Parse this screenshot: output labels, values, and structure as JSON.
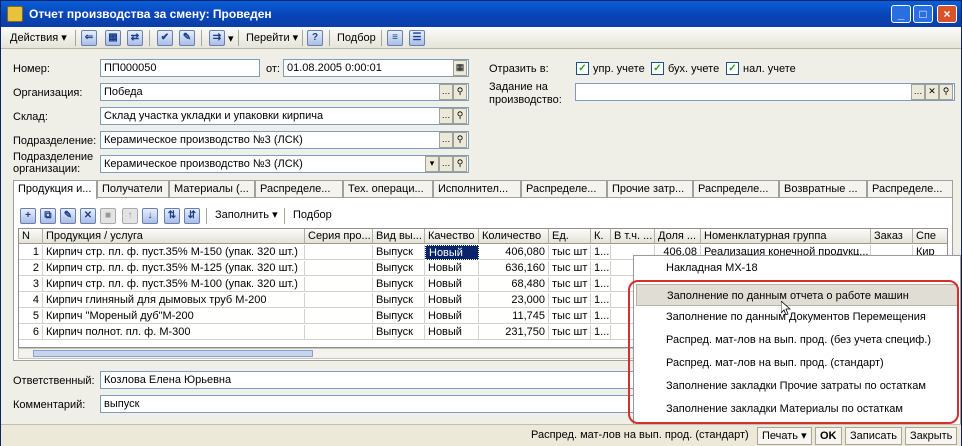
{
  "window": {
    "title": "Отчет производства за смену: Проведен",
    "min": "_",
    "max": "□",
    "close": "×"
  },
  "toolbar": {
    "actions": "Действия",
    "goto": "Перейти",
    "help": "?",
    "select": "Подбор"
  },
  "form": {
    "number_label": "Номер:",
    "number_value": "ПП000050",
    "from_label": "от:",
    "date_value": "01.08.2005  0:00:01",
    "org_label": "Организация:",
    "org_value": "Победа",
    "warehouse_label": "Склад:",
    "warehouse_value": "Склад участка укладки и упаковки кирпича",
    "division_label": "Подразделение:",
    "division_value": "Керамическое производство №3 (ЛСК)",
    "org_division_label_1": "Подразделение",
    "org_division_label_2": "организации:",
    "org_division_value": "Керамическое производство №3 (ЛСК)",
    "reflect_label": "Отразить в:",
    "reflect_mgmt": "упр. учете",
    "reflect_acc": "бух. учете",
    "reflect_tax": "нал. учете",
    "task_label_1": "Задание на",
    "task_label_2": "производство:",
    "task_value": "",
    "responsible_label": "Ответственный:",
    "responsible_value": "Козлова Елена Юрьевна",
    "comment_label": "Комментарий:",
    "comment_value": "выпуск"
  },
  "tabs": [
    "Продукция и...",
    "Получатели",
    "Материалы (...",
    "Распределе...",
    "Тех. операци...",
    "Исполнител...",
    "Распределе...",
    "Прочие затр...",
    "Распределе...",
    "Возвратные ...",
    "Распределе..."
  ],
  "panel_toolbar": {
    "fill": "Заполнить",
    "select": "Подбор"
  },
  "grid": {
    "headers": [
      "N",
      "Продукция / услуга",
      "Серия про...",
      "Вид вы...",
      "Качество",
      "Количество",
      "Ед.",
      "К.",
      "В т.ч. ...",
      "Доля ...",
      "Номенклатурная группа",
      "Заказ",
      "Спе"
    ],
    "rows": [
      [
        "1",
        "Кирпич стр. пл. ф. пуст.35%  М-150 (упак. 320 шт.)",
        "",
        "Выпуск",
        "Новый",
        "406,080",
        "тыс шт",
        "1...",
        "",
        "406,08",
        "Реализация конечной продукц...",
        "",
        "Кир"
      ],
      [
        "2",
        "Кирпич стр. пл. ф. пуст.35%  М-125 (упак. 320 шт.)",
        "",
        "Выпуск",
        "Новый",
        "636,160",
        "тыс шт",
        "1...",
        "",
        "",
        "",
        "",
        ""
      ],
      [
        "3",
        "Кирпич стр. пл. ф. пуст.35%  М-100 (упак. 320 шт.)",
        "",
        "Выпуск",
        "Новый",
        "68,480",
        "тыс шт",
        "1...",
        "",
        "",
        "",
        "",
        ""
      ],
      [
        "4",
        "Кирпич глиняный для дымовых труб М-200",
        "",
        "Выпуск",
        "Новый",
        "23,000",
        "тыс шт",
        "1...",
        "",
        "",
        "",
        "",
        ""
      ],
      [
        "5",
        "Кирпич \"Мореный дуб\"М-200",
        "",
        "Выпуск",
        "Новый",
        "11,745",
        "тыс шт",
        "1...",
        "",
        "",
        "",
        "",
        ""
      ],
      [
        "6",
        "Кирпич полнот. пл. ф. М-300",
        "",
        "Выпуск",
        "Новый",
        "231,750",
        "тыс шт",
        "1...",
        "",
        "",
        "",
        "",
        ""
      ]
    ]
  },
  "popup": {
    "items": [
      "Накладная МХ-18",
      "Заполнение по данным отчета о работе машин",
      "Заполнение по данным Документов Перемещения",
      "Распред. мат-лов на вып. прод. (без учета специф.)",
      "Распред. мат-лов на вып. прод. (стандарт)",
      "Заполнение закладки Прочие затраты по остаткам",
      "Заполнение закладки Материалы по остаткам"
    ]
  },
  "status": {
    "last_action": "Распред. мат-лов на вып. прод. (стандарт)",
    "print": "Печать",
    "ok": "OK",
    "save": "Записать",
    "close": "Закрыть"
  }
}
